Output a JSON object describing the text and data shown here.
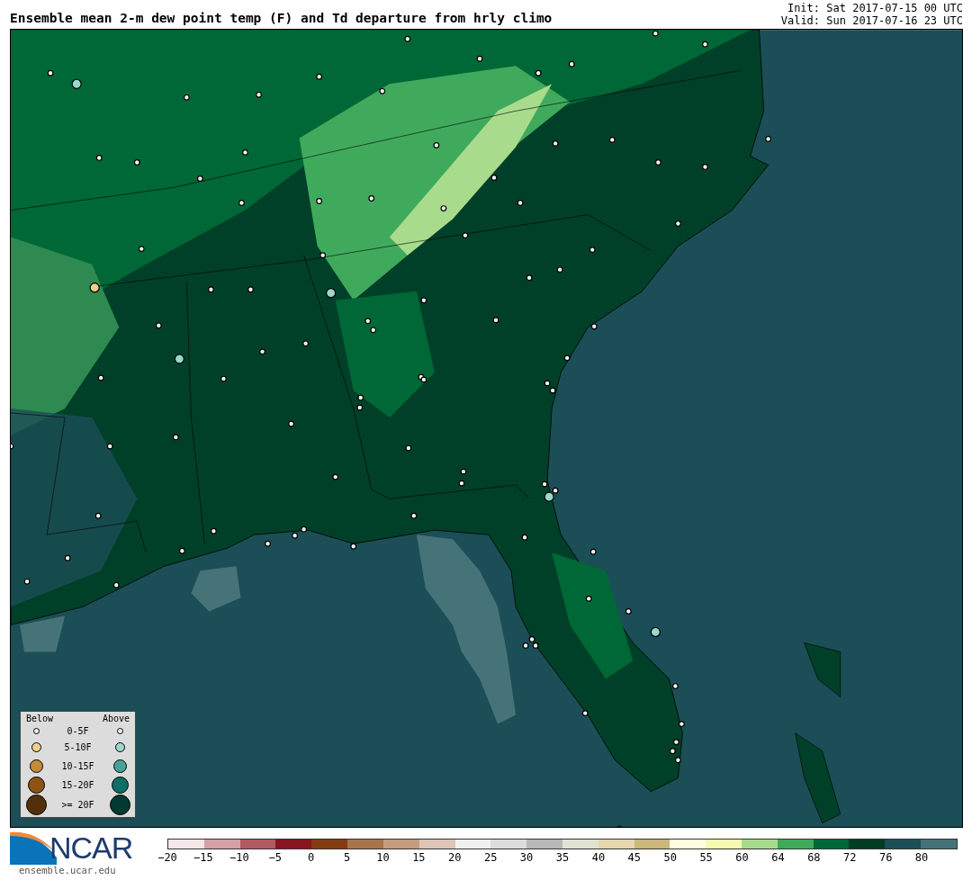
{
  "header": {
    "title": "Ensemble mean 2-m dew point temp (F) and Td departure from hrly climo",
    "init": "Init: Sat 2017-07-15 00 UTC",
    "valid": "Valid: Sun 2017-07-16 23 UTC"
  },
  "legend": {
    "below_label": "Below",
    "above_label": "Above",
    "rows": [
      {
        "label": "0-5F",
        "below": {
          "color": "#f0f0f0"
        },
        "above": {
          "color": "#f0f0f0"
        }
      },
      {
        "label": "5-10F",
        "below": {
          "color": "#ecd08c"
        },
        "above": {
          "color": "#9ad8cc"
        }
      },
      {
        "label": "10-15F",
        "below": {
          "color": "#c48a3a"
        },
        "above": {
          "color": "#48a29c"
        }
      },
      {
        "label": "15-20F",
        "below": {
          "color": "#8e5212"
        },
        "above": {
          "color": "#0c6e66"
        }
      },
      {
        "label": ">= 20F",
        "below": {
          "color": "#54300a"
        },
        "above": {
          "color": "#003a30"
        }
      }
    ]
  },
  "logo": {
    "name": "NCAR",
    "url": "ensemble.ucar.edu"
  },
  "colorbar": {
    "segments": [
      {
        "color": "#f5e6e8"
      },
      {
        "color": "#d4a0a8"
      },
      {
        "color": "#b05a62"
      },
      {
        "color": "#8a1520"
      },
      {
        "color": "#843c10"
      },
      {
        "color": "#a8744c"
      },
      {
        "color": "#c49c80"
      },
      {
        "color": "#dfc5b5"
      },
      {
        "color": "#f0f0f0"
      },
      {
        "color": "#dcdcdc"
      },
      {
        "color": "#b8b8b8"
      },
      {
        "color": "#dfe3d3"
      },
      {
        "color": "#e5d7ae"
      },
      {
        "color": "#ccb87a"
      },
      {
        "color": "#fdfde0"
      },
      {
        "color": "#f5fab0"
      },
      {
        "color": "#a8dc8c"
      },
      {
        "color": "#40aa5c"
      },
      {
        "color": "#006836"
      },
      {
        "color": "#003d24"
      },
      {
        "color": "#1b4e56"
      },
      {
        "color": "#467378"
      }
    ],
    "ticks": [
      "−20",
      "−15",
      "−10",
      "−5",
      "0",
      "5",
      "10",
      "15",
      "20",
      "25",
      "30",
      "35",
      "40",
      "45",
      "50",
      "55",
      "60",
      "64",
      "68",
      "72",
      "76",
      "80"
    ]
  }
}
